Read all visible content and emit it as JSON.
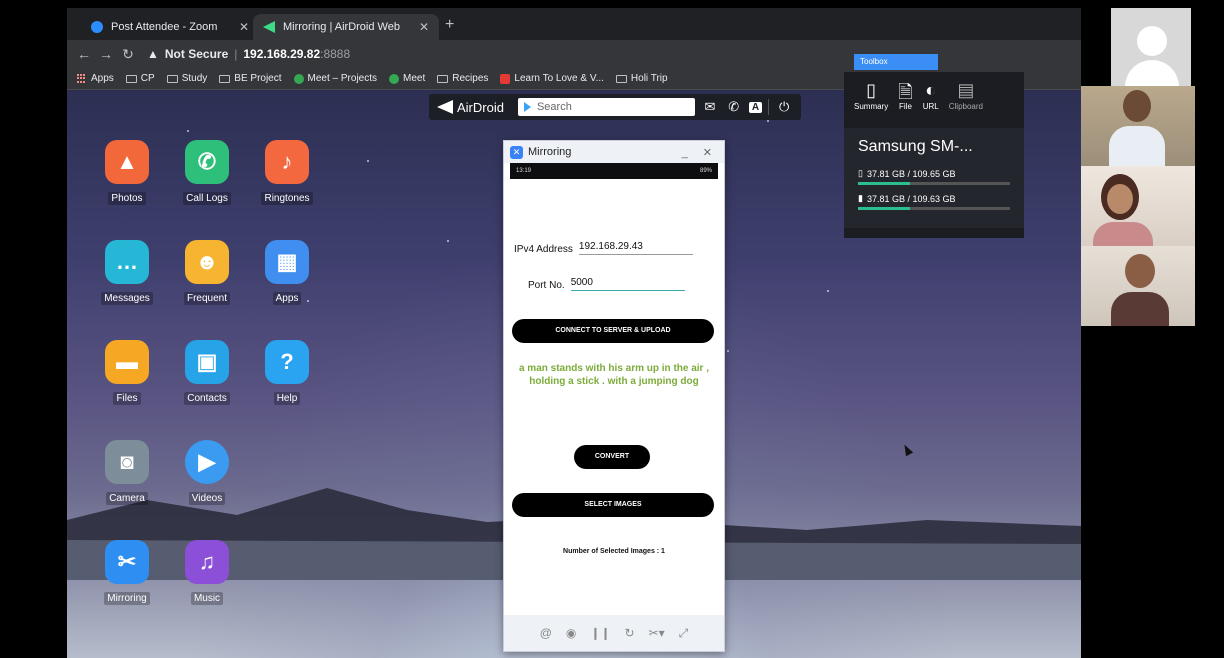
{
  "browser": {
    "tabs": [
      {
        "title": "Post Attendee - Zoom"
      },
      {
        "title": "Mirroring | AirDroid Web"
      }
    ],
    "address": {
      "security": "Not Secure",
      "host": "192.168.29.82",
      "port": ":8888"
    },
    "bookmarks": [
      "Apps",
      "CP",
      "Study",
      "BE Project",
      "Meet – Projects",
      "Meet",
      "Recipes",
      "Learn To Love & V...",
      "Holi Trip"
    ]
  },
  "airdroid": {
    "brand": "AirDroid",
    "search_placeholder": "Search",
    "apps": [
      {
        "label": "Photos",
        "color": "#f2683a"
      },
      {
        "label": "Call Logs",
        "color": "#2ec07a"
      },
      {
        "label": "Ringtones",
        "color": "#f4683f"
      },
      {
        "label": "Messages",
        "color": "#27b7d6"
      },
      {
        "label": "Frequent",
        "color": "#f6b430"
      },
      {
        "label": "Apps",
        "color": "#3f8ef0"
      },
      {
        "label": "Files",
        "color": "#f6a723"
      },
      {
        "label": "Contacts",
        "color": "#27a3e8"
      },
      {
        "label": "Help",
        "color": "#2aa3f0"
      },
      {
        "label": "Camera",
        "color": "#7d8d99"
      },
      {
        "label": "Videos",
        "color": "#3a9bf0"
      },
      {
        "label": "Mirroring",
        "color": "#2f8ef2"
      },
      {
        "label": "Music",
        "color": "#8b4fd8"
      }
    ]
  },
  "mirroring": {
    "title": "Mirroring",
    "status_time": "13:19",
    "status_battery": "89%",
    "ipv4_label": "IPv4 Address",
    "ipv4_value": "192.168.29.43",
    "port_label": "Port No.",
    "port_value": "5000",
    "connect_button": "CONNECT TO SERVER & UPLOAD",
    "caption": "a man stands with his arm up in the air , holding a stick . with a jumping dog",
    "convert_button": "CONVERT",
    "select_button": "SELECT IMAGES",
    "selected_count": "Number of Selected Images : 1"
  },
  "toolbox": {
    "tag": "Toolbox",
    "items": [
      "Summary",
      "File",
      "URL",
      "Clipboard"
    ],
    "device_name": "Samsung SM-...",
    "storage": [
      {
        "label": "37.81 GB / 109.65 GB",
        "fraction": 0.34
      },
      {
        "label": "37.81 GB / 109.63 GB",
        "fraction": 0.34
      }
    ]
  }
}
